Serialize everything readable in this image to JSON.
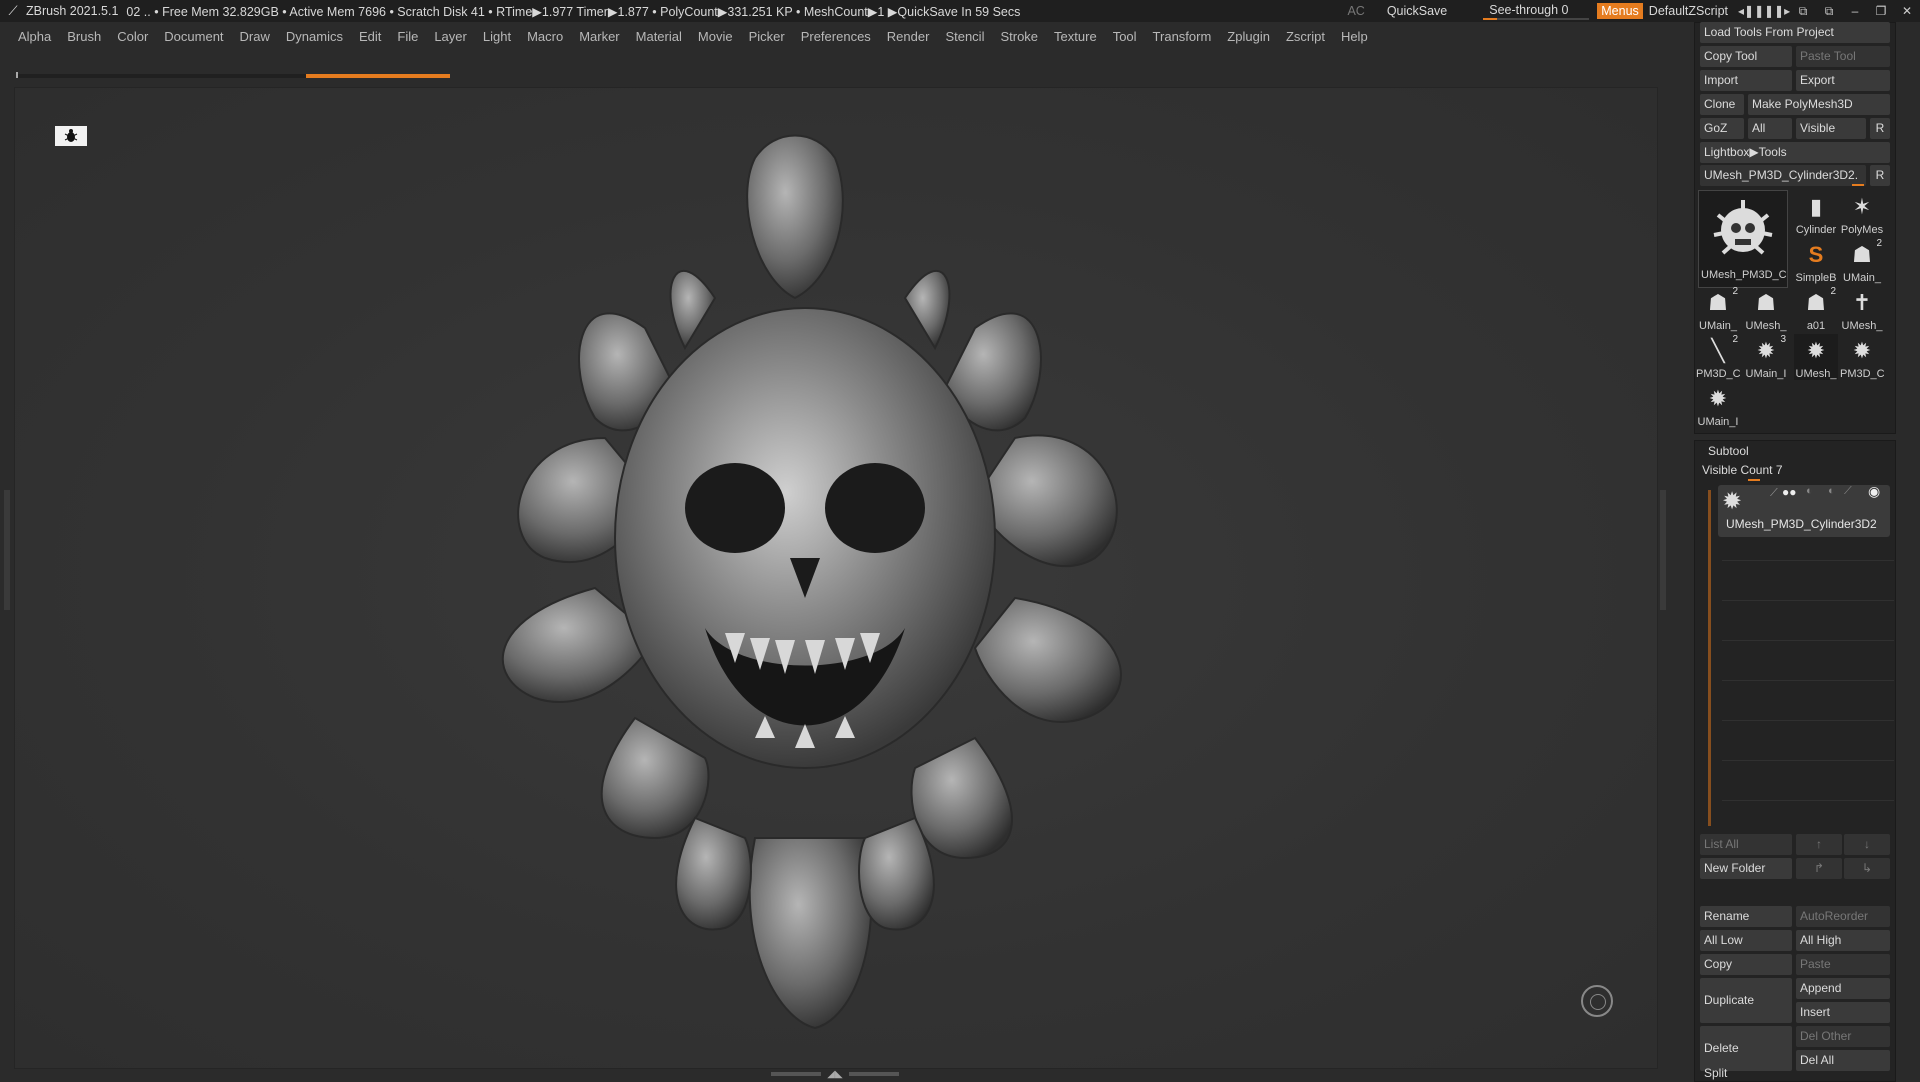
{
  "titlebar": {
    "app_title": "ZBrush 2021.5.1",
    "status_text": "02  .. • Free Mem 32.829GB • Active Mem 7696 • Scratch Disk 41 •  RTime▶1.977 Timer▶1.877 • PolyCount▶331.251 KP  • MeshCount▶1 ▶QuickSave In 59 Secs",
    "ac_label": "AC",
    "quicksave_label": "QuickSave",
    "seethrough_label": "See-through   0",
    "seethrough_value": 0,
    "menus_label": "Menus",
    "script_label": "DefaultZScript",
    "icons": [
      "layout-left-icon",
      "layout-right-icon",
      "window-swap-icon",
      "window-restore-icon",
      "minimize-icon",
      "maximize-icon",
      "close-icon"
    ],
    "icon_glyphs": [
      "◂❚❚",
      "❚❚▸",
      "⧉",
      "⧉",
      "–",
      "❐",
      "✕"
    ]
  },
  "menubar": {
    "items": [
      "Alpha",
      "Brush",
      "Color",
      "Document",
      "Draw",
      "Dynamics",
      "Edit",
      "File",
      "Layer",
      "Light",
      "Macro",
      "Marker",
      "Material",
      "Movie",
      "Picker",
      "Preferences",
      "Render",
      "Stencil",
      "Stroke",
      "Texture",
      "Tool",
      "Transform",
      "Zplugin",
      "Zscript",
      "Help"
    ]
  },
  "tool_panel": {
    "load_tools": "Load Tools From Project",
    "copy_tool": "Copy Tool",
    "paste_tool": "Paste Tool",
    "import": "Import",
    "export": "Export",
    "clone": "Clone",
    "make_polymesh": "Make PolyMesh3D",
    "goz": "GoZ",
    "all": "All",
    "visible": "Visible",
    "r1": "R",
    "lightbox_tools": "Lightbox▶Tools",
    "current_tool": "UMesh_PM3D_Cylinder3D2.",
    "r2": "R",
    "big_thumb_caption": "UMesh_PM3D_C",
    "thumbs": [
      {
        "caption": "Cylinder",
        "glyph": "▮",
        "num": ""
      },
      {
        "caption": "PolyMes",
        "glyph": "✶",
        "num": ""
      },
      {
        "caption": "SimpleB",
        "glyph": "S",
        "num": ""
      },
      {
        "caption": "UMain_",
        "glyph": "☗",
        "num": "2"
      },
      {
        "caption": "UMain_",
        "glyph": "☗",
        "num": "2"
      },
      {
        "caption": "UMesh_",
        "glyph": "☗",
        "num": ""
      },
      {
        "caption": "a01",
        "glyph": "☗",
        "num": "2"
      },
      {
        "caption": "UMesh_",
        "glyph": "✝",
        "num": ""
      },
      {
        "caption": "PM3D_C",
        "glyph": "╲",
        "num": "2"
      },
      {
        "caption": "UMain_I",
        "glyph": "✹",
        "num": "3"
      },
      {
        "caption": "UMesh_",
        "glyph": "✹",
        "num": ""
      },
      {
        "caption": "PM3D_C",
        "glyph": "✹",
        "num": ""
      },
      {
        "caption": "UMain_I",
        "glyph": "✹",
        "num": ""
      }
    ]
  },
  "subtool": {
    "header": "Subtool",
    "visible_count": "Visible Count 7",
    "item_name": "UMesh_PM3D_Cylinder3D2",
    "list_all": "List All",
    "new_folder": "New Folder",
    "rename": "Rename",
    "autoreorder": "AutoReorder",
    "all_low": "All Low",
    "all_high": "All High",
    "copy": "Copy",
    "paste": "Paste",
    "duplicate": "Duplicate",
    "append": "Append",
    "insert": "Insert",
    "delete": "Delete",
    "del_other": "Del Other",
    "del_all": "Del All",
    "split": "Split"
  },
  "colors": {
    "accent": "#e57c1f",
    "background": "#2b2b2b",
    "panel": "#232323"
  }
}
